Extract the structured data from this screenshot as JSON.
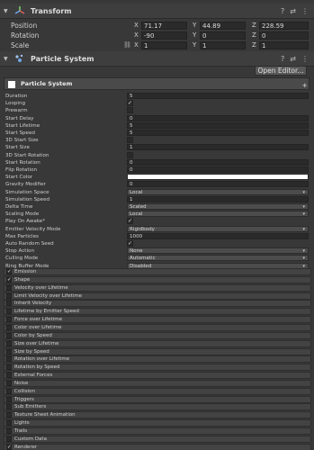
{
  "transform": {
    "title": "Transform",
    "fold_icon": "triangle-down-icon",
    "component_icon": "transform-gizmo-icon",
    "tools": [
      "?",
      "⇄",
      "⋮"
    ],
    "position": {
      "label": "Position",
      "x": "71.17",
      "y": "44.89",
      "z": "228.59"
    },
    "rotation": {
      "label": "Rotation",
      "x": "-90",
      "y": "0",
      "z": "0"
    },
    "scale": {
      "label": "Scale",
      "link_icon": "constrain-proportions-icon",
      "x": "1",
      "y": "1",
      "z": "1"
    },
    "axes": {
      "x": "X",
      "y": "Y",
      "z": "Z"
    }
  },
  "particle_system": {
    "title": "Particle System",
    "fold_icon": "triangle-down-icon",
    "component_icon": "particle-system-icon",
    "tools": [
      "?",
      "⇄",
      "⋮"
    ],
    "open_editor": "Open Editor...",
    "system_name": "Particle System",
    "properties": [
      {
        "label": "Duration",
        "kind": "field",
        "value": "5"
      },
      {
        "label": "Looping",
        "kind": "check",
        "checked": true
      },
      {
        "label": "Prewarm",
        "kind": "check",
        "checked": false
      },
      {
        "label": "Start Delay",
        "kind": "field",
        "value": "0"
      },
      {
        "label": "Start Lifetime",
        "kind": "field",
        "value": "5"
      },
      {
        "label": "Start Speed",
        "kind": "field",
        "value": "5"
      },
      {
        "label": "3D Start Size",
        "kind": "check",
        "checked": false
      },
      {
        "label": "Start Size",
        "kind": "field",
        "value": "1"
      },
      {
        "label": "3D Start Rotation",
        "kind": "check",
        "checked": false
      },
      {
        "label": "Start Rotation",
        "kind": "field",
        "value": "0"
      },
      {
        "label": "Flip Rotation",
        "kind": "field",
        "value": "0"
      },
      {
        "label": "Start Color",
        "kind": "color",
        "value": "#ffffff"
      },
      {
        "label": "Gravity Modifier",
        "kind": "field",
        "value": "0"
      },
      {
        "label": "Simulation Space",
        "kind": "dropdown",
        "value": "Local"
      },
      {
        "label": "Simulation Speed",
        "kind": "field",
        "value": "1"
      },
      {
        "label": "Delta Time",
        "kind": "dropdown",
        "value": "Scaled"
      },
      {
        "label": "Scaling Mode",
        "kind": "dropdown",
        "value": "Local"
      },
      {
        "label": "Play On Awake*",
        "kind": "check",
        "checked": true
      },
      {
        "label": "Emitter Velocity Mode",
        "kind": "dropdown",
        "value": "Rigidbody"
      },
      {
        "label": "Max Particles",
        "kind": "field",
        "value": "1000"
      },
      {
        "label": "Auto Random Seed",
        "kind": "check",
        "checked": true
      },
      {
        "label": "Stop Action",
        "kind": "dropdown",
        "value": "None"
      },
      {
        "label": "Culling Mode",
        "kind": "dropdown",
        "value": "Automatic"
      },
      {
        "label": "Ring Buffer Mode",
        "kind": "dropdown",
        "value": "Disabled"
      }
    ],
    "modules": [
      {
        "label": "Emission",
        "checked": true
      },
      {
        "label": "Shape",
        "checked": true
      },
      {
        "label": "Velocity over Lifetime",
        "checked": false
      },
      {
        "label": "Limit Velocity over Lifetime",
        "checked": false
      },
      {
        "label": "Inherit Velocity",
        "checked": false
      },
      {
        "label": "Lifetime by Emitter Speed",
        "checked": false
      },
      {
        "label": "Force over Lifetime",
        "checked": false
      },
      {
        "label": "Color over Lifetime",
        "checked": false
      },
      {
        "label": "Color by Speed",
        "checked": false
      },
      {
        "label": "Size over Lifetime",
        "checked": false
      },
      {
        "label": "Size by Speed",
        "checked": false
      },
      {
        "label": "Rotation over Lifetime",
        "checked": false
      },
      {
        "label": "Rotation by Speed",
        "checked": false
      },
      {
        "label": "External Forces",
        "checked": false
      },
      {
        "label": "Noise",
        "checked": false
      },
      {
        "label": "Collision",
        "checked": false
      },
      {
        "label": "Triggers",
        "checked": false
      },
      {
        "label": "Sub Emitters",
        "checked": false
      },
      {
        "label": "Texture Sheet Animation",
        "checked": false
      },
      {
        "label": "Lights",
        "checked": false
      },
      {
        "label": "Trails",
        "checked": false
      },
      {
        "label": "Custom Data",
        "checked": false
      },
      {
        "label": "Renderer",
        "checked": true
      }
    ],
    "check_glyph": "✓",
    "dropdown_arrow": "▾",
    "add_icon": "plus-icon"
  },
  "colors": {
    "background": "#383838",
    "header": "#3e3e3e",
    "field": "#2a2a2a",
    "module": "#434343",
    "accent_blue": "#6fa7e6"
  }
}
